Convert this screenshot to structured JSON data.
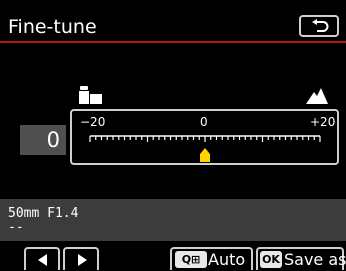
{
  "header": {
    "title": "Fine-tune",
    "back_icon": "return-arrow-icon"
  },
  "adjustment": {
    "value": "0",
    "scale_min_label": "−20",
    "scale_mid_label": "0",
    "scale_max_label": "+20",
    "scale_min": -20,
    "scale_max": 20,
    "current": 0,
    "left_icon": "camera-body-icon",
    "right_icon": "mountain-icon",
    "marker_color": "#ffd400"
  },
  "lens": {
    "name": "50mm F1.4",
    "second_line": "--"
  },
  "footer": {
    "left_icon": "arrow-left-icon",
    "right_icon": "arrow-right-icon",
    "auto_key": "Q⊞",
    "auto_label": "Auto",
    "save_key": "OK",
    "save_label": "Save as"
  },
  "colors": {
    "accent_rule": "#b01a1a",
    "value_box": "#4f4f4f",
    "lens_panel": "#3c3c3c"
  }
}
